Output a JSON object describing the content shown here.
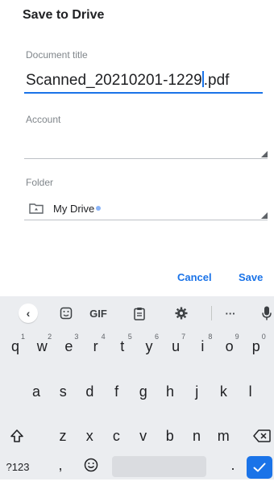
{
  "dialog": {
    "title": "Save to Drive",
    "document_title_label": "Document title",
    "document_title_value": "Scanned_20210201-1229",
    "document_title_ext": ".pdf",
    "account_label": "Account",
    "account_value": "",
    "folder_label": "Folder",
    "folder_value": "My Drive",
    "cancel_label": "Cancel",
    "save_label": "Save"
  },
  "keyboard": {
    "toolbar": {
      "back": "‹",
      "gif": "GIF",
      "more": "···"
    },
    "row1": [
      {
        "key": "q",
        "hint": "1"
      },
      {
        "key": "w",
        "hint": "2"
      },
      {
        "key": "e",
        "hint": "3"
      },
      {
        "key": "r",
        "hint": "4"
      },
      {
        "key": "t",
        "hint": "5"
      },
      {
        "key": "y",
        "hint": "6"
      },
      {
        "key": "u",
        "hint": "7"
      },
      {
        "key": "i",
        "hint": "8"
      },
      {
        "key": "o",
        "hint": "9"
      },
      {
        "key": "p",
        "hint": "0"
      }
    ],
    "row2": [
      "a",
      "s",
      "d",
      "f",
      "g",
      "h",
      "j",
      "k",
      "l"
    ],
    "row3": [
      "z",
      "x",
      "c",
      "v",
      "b",
      "n",
      "m"
    ],
    "row4": {
      "symbols": "?123",
      "comma": ",",
      "period": "."
    }
  },
  "colors": {
    "accent": "#1a73e8",
    "keyboard_bg": "#ebedf0"
  }
}
